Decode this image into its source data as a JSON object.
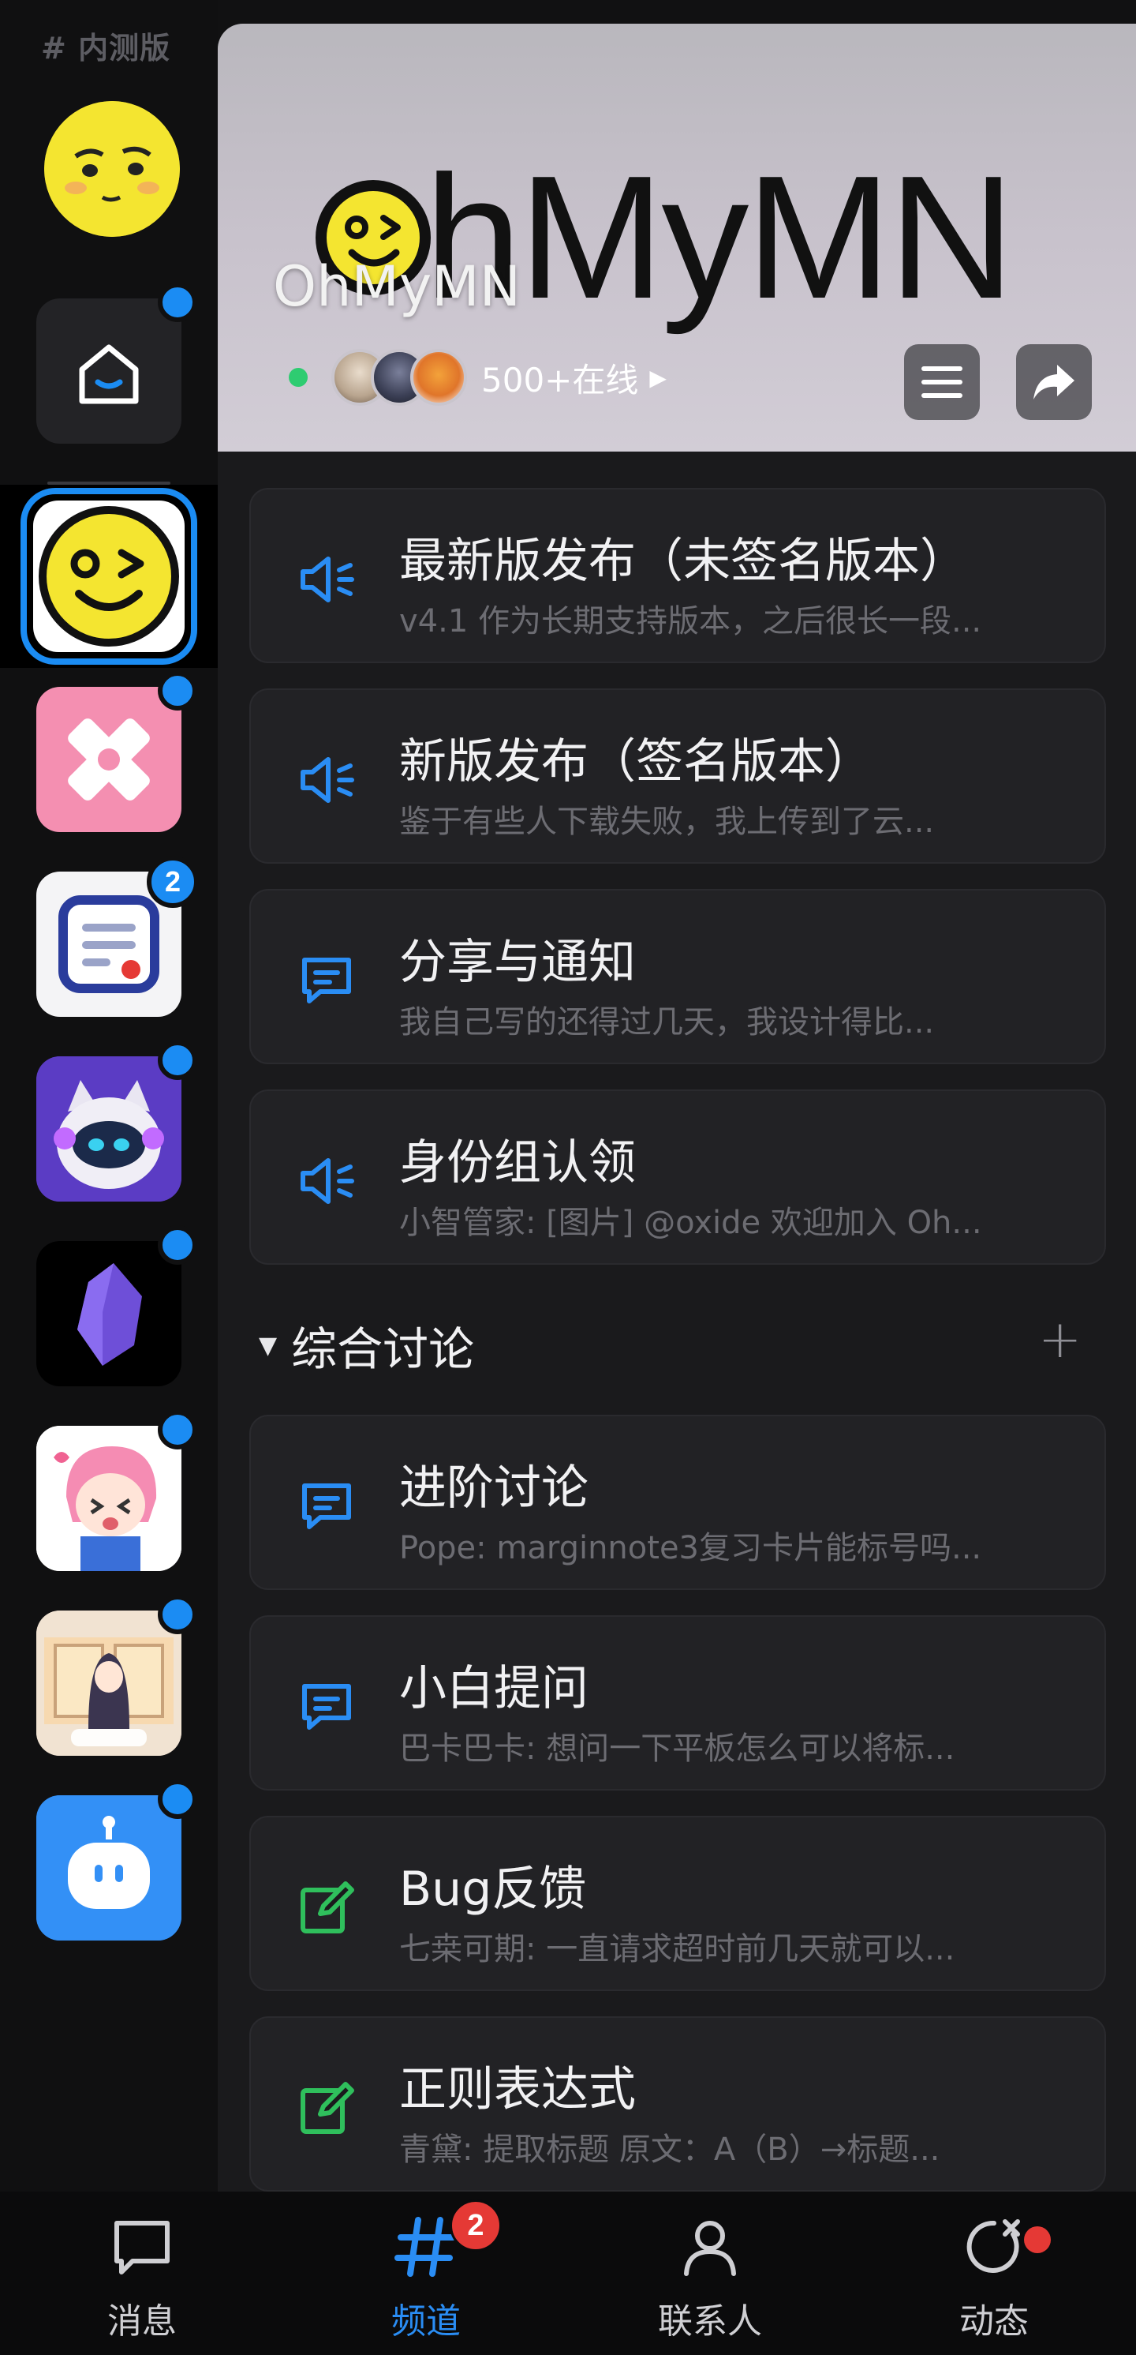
{
  "rail": {
    "tag": "# 内测版",
    "servers": [
      {
        "name": "home",
        "badge": "dot"
      },
      {
        "name": "OhMyMN",
        "active": true
      },
      {
        "name": "pink-bandage",
        "badge": "dot"
      },
      {
        "name": "blue-doc",
        "badge": "2"
      },
      {
        "name": "robot-cat",
        "badge": "dot"
      },
      {
        "name": "obsidian",
        "badge": "dot"
      },
      {
        "name": "anime-girl",
        "badge": "dot"
      },
      {
        "name": "anime-scene",
        "badge": "dot"
      },
      {
        "name": "blue-bot",
        "badge": "dot"
      }
    ]
  },
  "banner": {
    "logo_text": "OhMyMN",
    "title": "OhMyMN",
    "online_text": "500+在线"
  },
  "channels": [
    {
      "title": "最新版发布（未签名版本）",
      "subtitle": "v4.1 作为长期支持版本，之后很长一段...",
      "icon": "announcement-icon"
    },
    {
      "title": "新版发布（签名版本）",
      "subtitle": "鉴于有些人下载失败，我上传到了云...",
      "icon": "announcement-icon"
    },
    {
      "title": "分享与通知",
      "subtitle": "我自己写的还得过几天，我设计得比...",
      "icon": "chat-icon"
    },
    {
      "title": "身份组认领",
      "subtitle": "小智管家: [图片] @oxide 欢迎加入 Oh...",
      "icon": "announcement-icon"
    }
  ],
  "section": {
    "title": "综合讨论"
  },
  "discussion": [
    {
      "title": "进阶讨论",
      "subtitle": "Pope: marginnote3复习卡片能标号吗...",
      "icon": "chat-icon"
    },
    {
      "title": "小白提问",
      "subtitle": "巴卡巴卡: 想问一下平板怎么可以将标...",
      "icon": "chat-icon"
    },
    {
      "title": "Bug反馈",
      "subtitle": "七桒可期: 一直请求超时前几天就可以...",
      "icon": "edit-icon"
    },
    {
      "title": "正则表达式",
      "subtitle": "青黛: 提取标题 原文：A（B）→标题...",
      "icon": "edit-icon"
    }
  ],
  "nav": {
    "messages": "消息",
    "channels": "频道",
    "channels_badge": "2",
    "contacts": "联系人",
    "moments": "动态"
  },
  "colors": {
    "accent": "#1b8cf3",
    "green_icon": "#2fbf5c",
    "badge_red": "#e53935"
  }
}
